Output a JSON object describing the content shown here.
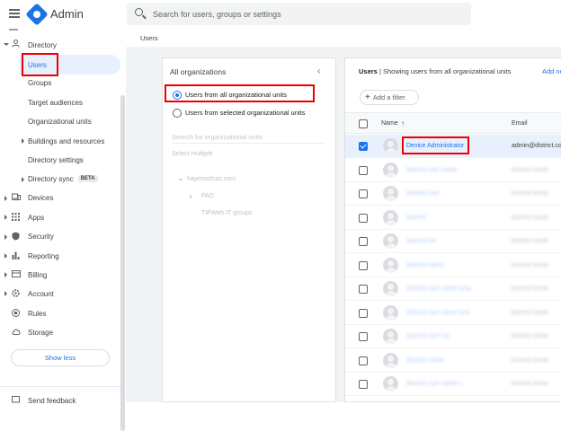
{
  "header": {
    "app_title": "Admin",
    "search_placeholder": "Search for users, groups or settings"
  },
  "breadcrumb": "Users",
  "sidebar": {
    "directory": "Directory",
    "users": "Users",
    "groups": "Groups",
    "target_audiences": "Target audiences",
    "org_units": "Organizational units",
    "buildings": "Buildings and resources",
    "directory_settings": "Directory settings",
    "directory_sync": "Directory sync",
    "beta": "BETA",
    "devices": "Devices",
    "apps": "Apps",
    "security": "Security",
    "reporting": "Reporting",
    "billing": "Billing",
    "account": "Account",
    "rules": "Rules",
    "storage": "Storage",
    "show_less": "Show less",
    "send_feedback": "Send feedback"
  },
  "org_panel": {
    "title": "All organizations",
    "option_all": "Users from all organizational units",
    "option_selected": "Users from selected organizational units",
    "search_placeholder": "Search for organizational units",
    "select_multiple": "Select multiple",
    "root": "hayessofsso.com",
    "child1": "PAD",
    "child2": "TIPWeb IT groups"
  },
  "users_panel": {
    "heading_bold": "Users",
    "heading_rest": " | Showing users from all organizational units",
    "add_new": "Add ne",
    "add_filter": "Add a filter",
    "col_name": "Name",
    "col_email": "Email",
    "rows": [
      {
        "name": "Device Administrator",
        "email": "admin@district.co",
        "selected": true
      },
      {
        "name": "blurred user name",
        "email": "blurred email",
        "selected": false
      },
      {
        "name": "blurred user",
        "email": "blurred email",
        "selected": false
      },
      {
        "name": "blurred",
        "email": "blurred email",
        "selected": false
      },
      {
        "name": "blurred nm",
        "email": "blurred email",
        "selected": false
      },
      {
        "name": "blurred name",
        "email": "blurred email",
        "selected": false
      },
      {
        "name": "blurred user name long",
        "email": "blurred email",
        "selected": false
      },
      {
        "name": "blurred user name one",
        "email": "blurred email",
        "selected": false
      },
      {
        "name": "blurred user na",
        "email": "blurred email",
        "selected": false
      },
      {
        "name": "blurred name",
        "email": "blurred email",
        "selected": false
      },
      {
        "name": "blurred user name x",
        "email": "blurred email",
        "selected": false
      }
    ]
  }
}
